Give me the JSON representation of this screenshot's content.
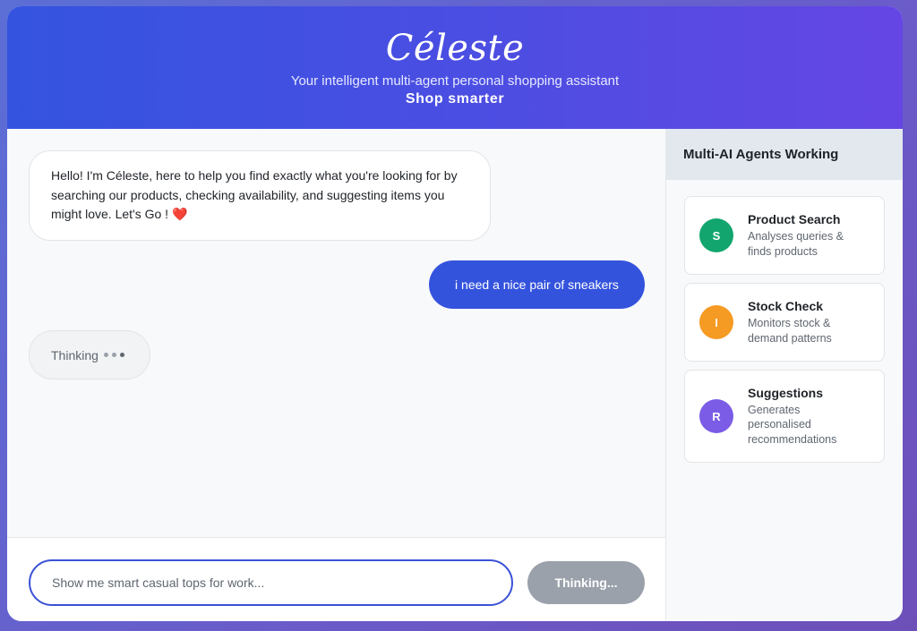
{
  "header": {
    "brand": "Céleste",
    "tagline": "Your intelligent multi-agent personal shopping assistant",
    "motto": "Shop smarter"
  },
  "messages": {
    "bot_greeting": "Hello! I'm Céleste, here to help you find exactly what you're looking for by searching our products, checking availability, and suggesting items you might love. Let's Go !",
    "bot_greeting_emoji": "❤️",
    "user_message": "i need a nice pair of sneakers",
    "thinking_label": "Thinking"
  },
  "input": {
    "placeholder": "Show me smart casual tops for work...",
    "value": "",
    "send_label": "Thinking..."
  },
  "sidebar": {
    "title": "Multi-AI Agents Working",
    "agents": [
      {
        "initial": "S",
        "name": "Product Search",
        "description": "Analyses queries & finds products",
        "color": "#12a66e"
      },
      {
        "initial": "I",
        "name": "Stock Check",
        "description": "Monitors stock & demand patterns",
        "color": "#f59a23"
      },
      {
        "initial": "R",
        "name": "Suggestions",
        "description": "Generates personalised recommendations",
        "color": "#7b5ce6"
      }
    ]
  },
  "colors": {
    "accent": "#3453dd",
    "header_gradient_start": "#3454e0",
    "header_gradient_end": "#6546e4",
    "disabled_button": "#9aa1ab"
  }
}
